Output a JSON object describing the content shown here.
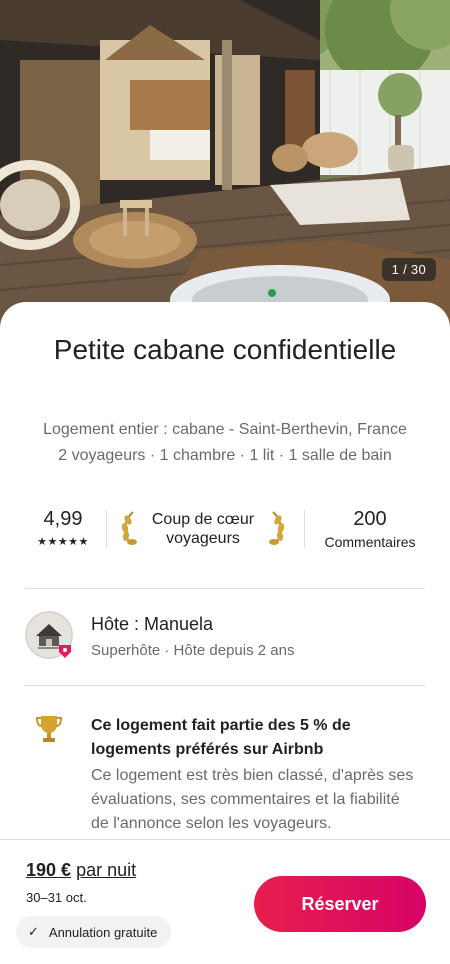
{
  "hero": {
    "photo_counter": "1 / 30"
  },
  "listing": {
    "title": "Petite cabane confidentielle",
    "location_line": "Logement entier : cabane - Saint-Berthevin, France",
    "details_line": "2 voyageurs · 1 chambre · 1 lit · 1 salle de bain"
  },
  "stats": {
    "rating": "4,99",
    "stars": "★★★★★",
    "favorite_line1": "Coup de cœur",
    "favorite_line2": "voyageurs",
    "reviews_count": "200",
    "reviews_label": "Commentaires"
  },
  "host": {
    "name": "Hôte : Manuela",
    "subtitle": "Superhôte · Hôte depuis 2 ans"
  },
  "highlight": {
    "title": "Ce logement fait partie des 5 % de logements préférés sur Airbnb",
    "description": "Ce logement est très bien classé, d'après ses évaluations, ses commentaires et la fiabilité de l'annonce selon les voyageurs."
  },
  "footer": {
    "price": "190 €",
    "price_unit": "par nuit",
    "dates": "30–31 oct.",
    "cancellation": "Annulation gratuite",
    "reserve_label": "Réserver"
  },
  "colors": {
    "brand_gradient_start": "#e61e4d",
    "brand_gradient_end": "#d70466",
    "text_primary": "#222222",
    "text_secondary": "#6a6a6a"
  }
}
